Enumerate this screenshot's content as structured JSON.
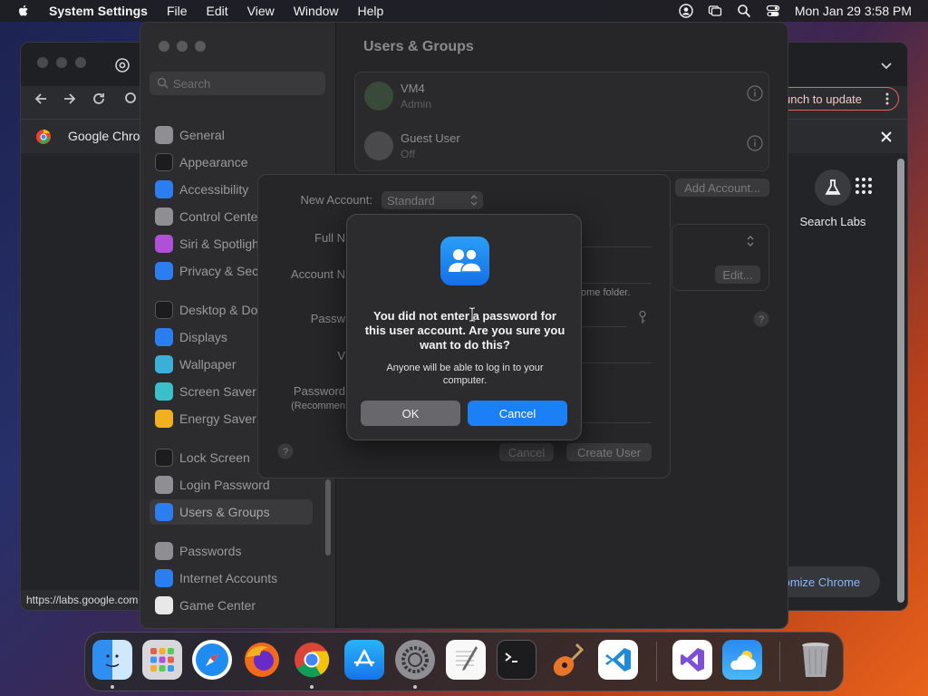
{
  "menubar": {
    "app_name": "System Settings",
    "menus": [
      "File",
      "Edit",
      "View",
      "Window",
      "Help"
    ],
    "datetime": "Mon Jan 29  3:58 PM"
  },
  "chrome": {
    "update_label": "unch to update",
    "tab_label": "Google Chrome",
    "labs_label": "Search Labs",
    "customize_label": "tomize Chrome",
    "status_url": "https://labs.google.com"
  },
  "settings": {
    "search_placeholder": "Search",
    "sidebar": [
      {
        "label": "General",
        "icon": "gear-icon",
        "color": "#8e8e93"
      },
      {
        "label": "Appearance",
        "icon": "appearance-icon",
        "color": "#1c1c1e"
      },
      {
        "label": "Accessibility",
        "icon": "accessibility-icon",
        "color": "#2a7ef0"
      },
      {
        "label": "Control Center",
        "icon": "control-center-icon",
        "color": "#8e8e93"
      },
      {
        "label": "Siri & Spotlight",
        "icon": "siri-icon",
        "color": "#b04fd8"
      },
      {
        "label": "Privacy & Security",
        "icon": "hand-icon",
        "color": "#2a7ef0"
      },
      {
        "label": "Desktop & Dock",
        "icon": "dock-icon",
        "color": "#1c1c1e"
      },
      {
        "label": "Displays",
        "icon": "sun-icon",
        "color": "#2a7ef0"
      },
      {
        "label": "Wallpaper",
        "icon": "wallpaper-icon",
        "color": "#3ab0d8"
      },
      {
        "label": "Screen Saver",
        "icon": "screen-saver-icon",
        "color": "#3ac0c8"
      },
      {
        "label": "Energy Saver",
        "icon": "lightbulb-icon",
        "color": "#f0b020"
      },
      {
        "label": "Lock Screen",
        "icon": "lock-icon",
        "color": "#1c1c1e"
      },
      {
        "label": "Login Password",
        "icon": "login-password-icon",
        "color": "#8e8e93"
      },
      {
        "label": "Users & Groups",
        "icon": "users-icon",
        "color": "#2a7ef0"
      },
      {
        "label": "Passwords",
        "icon": "key-icon",
        "color": "#8e8e93"
      },
      {
        "label": "Internet Accounts",
        "icon": "at-icon",
        "color": "#2a7ef0"
      },
      {
        "label": "Game Center",
        "icon": "game-center-icon",
        "color": "#e8e8e8"
      }
    ],
    "title": "Users & Groups",
    "users": [
      {
        "name": "VM4",
        "role": "Admin"
      },
      {
        "name": "Guest User",
        "role": "Off"
      }
    ],
    "add_account_label": "Add Account...",
    "edit_label": "Edit..."
  },
  "sheet": {
    "new_account_label": "New Account:",
    "account_type": "Standard",
    "full_name_label": "Full N",
    "account_name_label": "Account N",
    "home_folder_note": "ome folder.",
    "password_label": "Passw",
    "verify_label": "V",
    "hint_label": "Password",
    "hint_sub": "(Recommen",
    "cancel_label": "Cancel",
    "create_label": "Create User"
  },
  "alert": {
    "title": "You did not enter a password for this user account. Are you sure you want to do this?",
    "message": "Anyone will be able to log in to your computer.",
    "ok_label": "OK",
    "cancel_label": "Cancel",
    "accent": "#1b7ff5"
  },
  "dock": {
    "apps": [
      "Finder",
      "Launchpad",
      "Safari",
      "Firefox",
      "Google Chrome",
      "App Store",
      "System Settings",
      "TextEdit",
      "Terminal",
      "GarageBand",
      "Visual Studio Code",
      "Visual Studio",
      "Weather",
      "Trash"
    ]
  }
}
